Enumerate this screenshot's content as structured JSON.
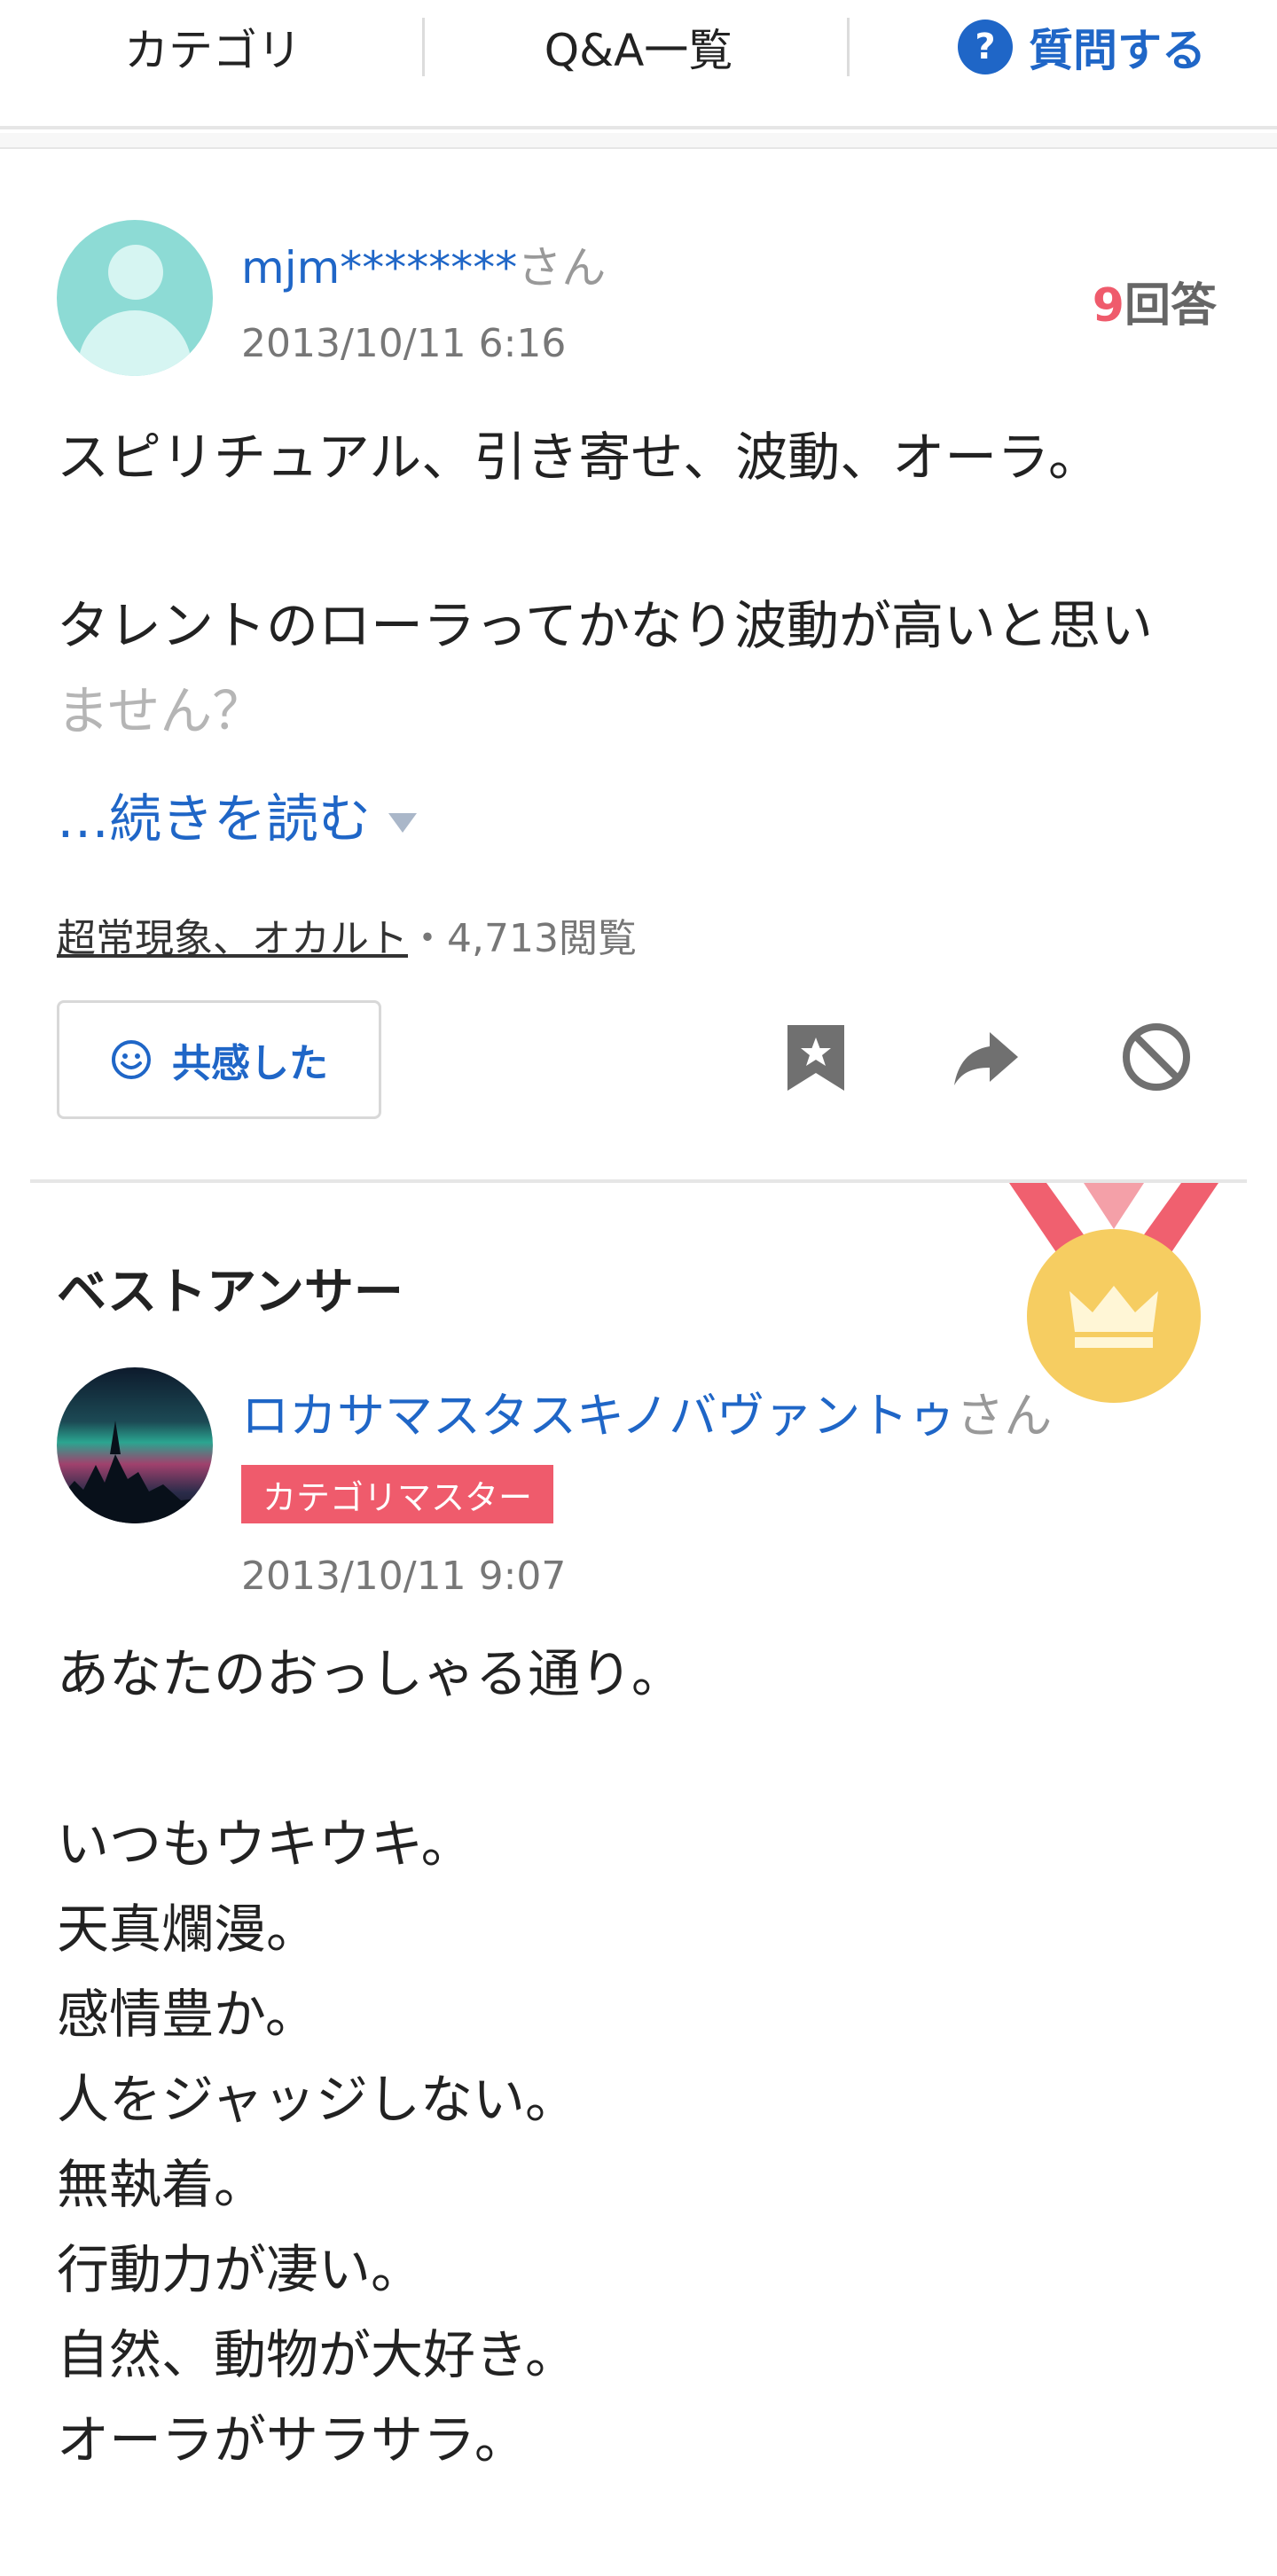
{
  "nav": {
    "category": "カテゴリ",
    "qa_list": "Q&A一覧",
    "ask": "質問する",
    "ask_icon": "?"
  },
  "question": {
    "user": "mjm********",
    "honorific": "さん",
    "date": "2013/10/11 6:16",
    "answer_count": "9",
    "answer_suffix": "回答",
    "lines": [
      "スピリチュアル、引き寄せ、波動、オーラ。",
      "タレントのローラってかなり波動が高いと思い",
      "ません？"
    ],
    "read_more": "…続きを読む",
    "category": "超常現象、オカルト",
    "views": "・4,713閲覧",
    "empathy_label": "共感した"
  },
  "best_answer": {
    "title": "ベストアンサー",
    "user": "ロカサマスタスキノバヴァントゥ",
    "honorific": "さん",
    "badge": "カテゴリマスター",
    "date": "2013/10/11 9:07",
    "lines": [
      "あなたのおっしゃる通り。",
      "いつもウキウキ。",
      "天真爛漫。",
      "感情豊か。",
      "人をジャッジしない。",
      "無執着。",
      "行動力が凄い。",
      "自然、動物が大好き。",
      "オーラがサラサラ。"
    ]
  },
  "colors": {
    "link_blue": "#1f66c7",
    "accent_red": "#ef5b6c",
    "medal_gold": "#f6cd61"
  },
  "icons": [
    "question-mark-icon",
    "smile-icon",
    "bookmark-icon",
    "share-icon",
    "block-icon",
    "medal-icon",
    "crown-icon"
  ]
}
